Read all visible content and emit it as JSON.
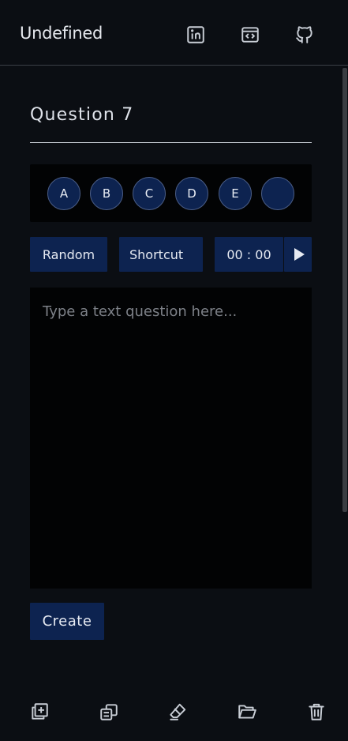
{
  "header": {
    "brand": "Undefined",
    "icons": [
      "linkedin-icon",
      "code-embed-icon",
      "github-icon"
    ]
  },
  "question": {
    "title": "Question 7"
  },
  "options": [
    "A",
    "B",
    "C",
    "D",
    "E",
    ""
  ],
  "controls": {
    "random_label": "Random",
    "shortcut_label": "Shortcut",
    "timer": "00 : 00",
    "play_icon": "play-icon"
  },
  "editor": {
    "value": "",
    "placeholder": "Type a text question here..."
  },
  "actions": {
    "create_label": "Create"
  },
  "footer": {
    "icons": [
      "add-question-icon",
      "duplicate-icon",
      "eraser-icon",
      "folder-open-icon",
      "trash-icon"
    ]
  },
  "colors": {
    "background": "#0b0e13",
    "panel": "#020304",
    "accent": "#0d2350",
    "text": "#d8dde6"
  }
}
